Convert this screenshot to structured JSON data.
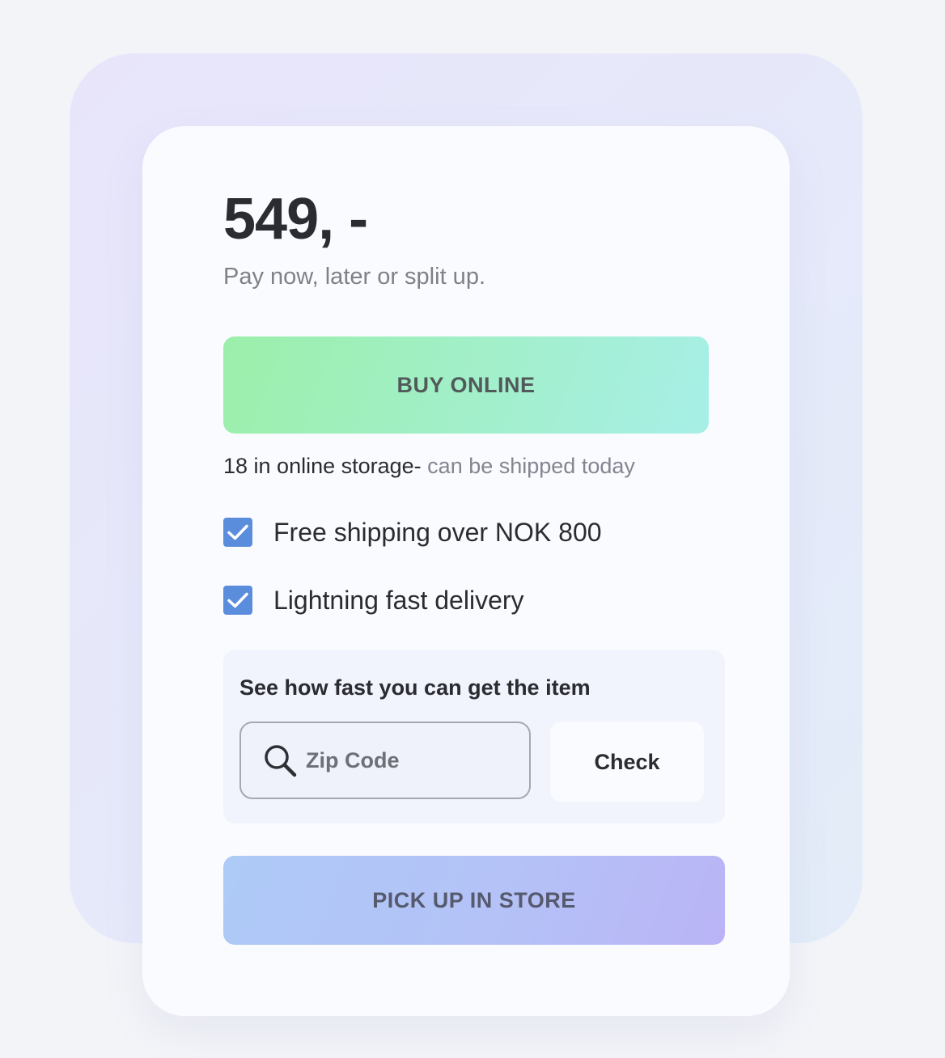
{
  "product": {
    "price": "549, -",
    "payment_note": "Pay now, later or split up."
  },
  "buy_online": {
    "label": "BUY ONLINE",
    "gradient": [
      "#9cefaa",
      "#a7efe7"
    ]
  },
  "stock": {
    "count_text": "18 in online storage-",
    "shipping_text": " can be shipped today"
  },
  "features": [
    {
      "label": "Free shipping over NOK 800",
      "checked": true
    },
    {
      "label": "Lightning fast delivery",
      "checked": true
    }
  ],
  "delivery_check": {
    "title": "See how fast you can get the item",
    "zip_placeholder": "Zip Code",
    "zip_value": "",
    "search_icon": "search-icon",
    "check_label": "Check"
  },
  "pick_up": {
    "label": "PICK UP IN STORE",
    "gradient": [
      "#aecaf7",
      "#bab4f6"
    ]
  },
  "colors": {
    "checkbox": "#5b8ddd",
    "text": "#2b2c31",
    "muted": "#808089"
  }
}
